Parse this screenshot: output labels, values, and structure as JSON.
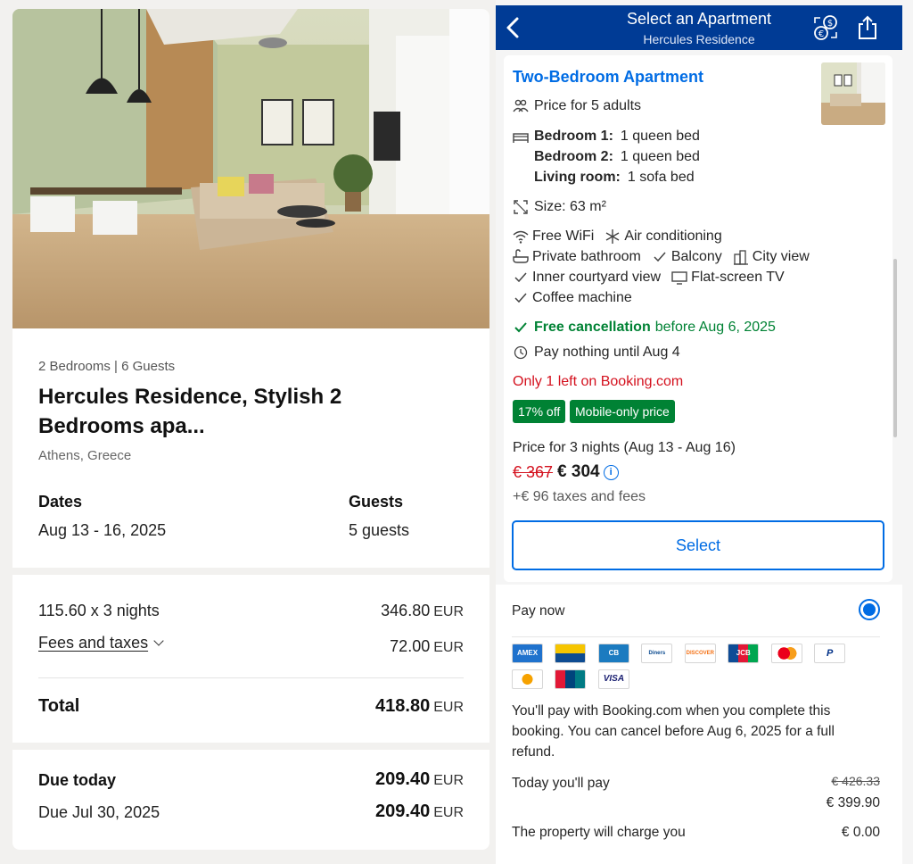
{
  "listing": {
    "meta": "2 Bedrooms | 6 Guests",
    "title": "Hercules Residence, Stylish 2 Bedrooms apa...",
    "location": "Athens, Greece",
    "dates_label": "Dates",
    "dates_value": "Aug 13 - 16, 2025",
    "guests_label": "Guests",
    "guests_value": "5 guests"
  },
  "breakdown": {
    "nights_label": "115.60 x 3 nights",
    "nights_amount": "346.80",
    "fees_label": "Fees and taxes",
    "fees_amount": "72.00",
    "currency": "EUR",
    "total_label": "Total",
    "total_amount": "418.80"
  },
  "due": {
    "today_label": "Due today",
    "today_amount": "209.40",
    "later_label": "Due Jul 30, 2025",
    "later_amount": "209.40",
    "currency": "EUR"
  },
  "navbar": {
    "title": "Select an Apartment",
    "subtitle": "Hercules Residence"
  },
  "apartment": {
    "title": "Two-Bedroom Apartment",
    "price_for": "Price for 5 adults",
    "bedroom1_label": "Bedroom 1:",
    "bedroom1_value": "1 queen bed",
    "bedroom2_label": "Bedroom 2:",
    "bedroom2_value": "1 queen bed",
    "living_label": "Living room:",
    "living_value": "1 sofa bed",
    "size": "Size: 63 m²",
    "amenities": [
      "Free WiFi",
      "Air conditioning",
      "Private bathroom",
      "Balcony",
      "City view",
      "Inner courtyard view",
      "Flat-screen TV",
      "Coffee machine"
    ],
    "free_cancel_bold": "Free cancellation",
    "free_cancel_rest": "before Aug 6, 2025",
    "pay_nothing": "Pay nothing until Aug 4",
    "only_left": "Only 1 left on Booking.com",
    "badge_discount": "17% off",
    "badge_mobile": "Mobile-only price",
    "price_nights": "Price for 3 nights (Aug 13 - Aug 16)",
    "price_old": "€ 367",
    "price_new": "€ 304",
    "taxes": "+€ 96 taxes and fees",
    "select_label": "Select"
  },
  "payment": {
    "pay_now": "Pay now",
    "card_labels": [
      "AMEX",
      "",
      "CB",
      "Diners Club",
      "DISCOVER",
      "JCB",
      "",
      "P",
      "",
      "",
      "VISA"
    ],
    "notice": "You'll pay with Booking.com when you complete this booking. You can cancel before Aug 6, 2025 for a full refund.",
    "today_label": "Today you'll pay",
    "today_old": "€ 426.33",
    "today_new": "€ 399.90",
    "property_label": "The property will charge you",
    "property_amount": "€ 0.00"
  }
}
